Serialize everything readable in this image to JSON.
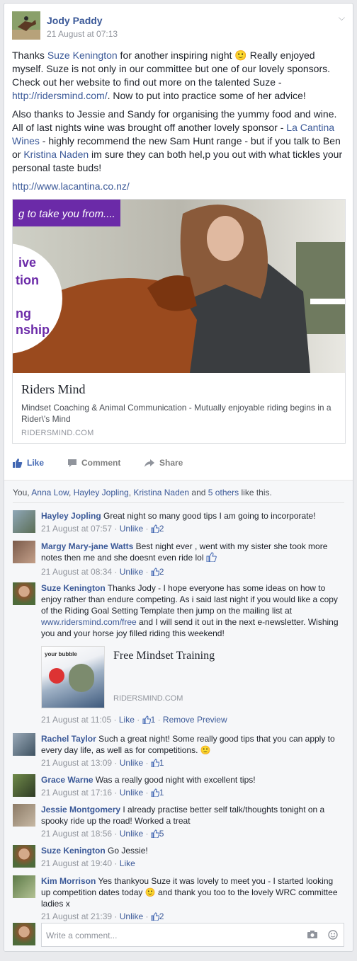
{
  "post": {
    "author": "Jody Paddy",
    "time": "21 August at 07:13",
    "para1": {
      "a": "Thanks ",
      "tag1": "Suze Kenington",
      "b": " for another inspiring night 🙂 Really enjoyed myself. Suze is not only in our committee but one of our lovely sponsors. Check out her website to find out more on the talented Suze - ",
      "link": "http://ridersmind.com/",
      "c": ". Now to put into practice some of her advice!"
    },
    "para2": {
      "a": "Also thanks to Jessie and Sandy for organising the yummy food and wine. All of last nights wine was brought off another lovely sponsor - ",
      "tag1": "La Cantina Wines",
      "b": " - highly recommend the new Sam Hunt range - but if you talk to Ben or ",
      "tag2": "Kristina Naden",
      "c": " im sure they can both hel,p you out with what tickles your personal taste buds!"
    },
    "para3_link": "http://www.lacantina.co.nz/"
  },
  "link_card": {
    "banner_text": "g to take you from....",
    "circle_lines": [
      "ive",
      "tion",
      "ng",
      "nship"
    ],
    "title": "Riders Mind",
    "description": "Mindset Coaching & Animal Communication - Mutually enjoyable riding begins in a Rider\\'s Mind",
    "domain": "RIDERSMIND.COM"
  },
  "actions": {
    "like": "Like",
    "comment": "Comment",
    "share": "Share"
  },
  "likes_summary": {
    "prefix": "You, ",
    "n1": "Anna Low",
    "sep1": ", ",
    "n2": "Hayley Jopling",
    "sep2": ", ",
    "n3": "Kristina Naden",
    "mid": " and ",
    "others": "5 others",
    "suffix": " like this."
  },
  "comments": [
    {
      "name": "Hayley Jopling",
      "text": " Great night so many good tips I am going to incorporate!",
      "time": "21 August at 07:57",
      "unlike": "Unlike",
      "likes": "2"
    },
    {
      "name": "Margy Mary-jane Watts",
      "text": " Best night ever , went with my sister she took more notes then me and she doesnt even ride lol",
      "time": "21 August at 08:34",
      "unlike": "Unlike",
      "likes": "2"
    },
    {
      "name": "Suze Kenington",
      "text": " Thanks Jody - I hope everyone has some ideas on how to enjoy rather than endure competing. As i said last night if you would like a copy of the Riding Goal Setting Template then jump on the mailing list at ",
      "link": "www.ridersmind.com/free",
      "text2": " and I will send it out in the next e-newsletter. Wishing you and your horse joy filled riding this weekend!",
      "preview_title": "Free Mindset Training",
      "preview_domain": "RIDERSMIND.COM",
      "preview_badge": "your bubble",
      "time": "21 August at 11:05",
      "like": "Like",
      "likes": "1",
      "remove": "Remove Preview"
    },
    {
      "name": "Rachel Taylor",
      "text": " Such a great night! Some really good tips that you can apply to every day life, as well as for competitions. 🙂",
      "time": "21 August at 13:09",
      "unlike": "Unlike",
      "likes": "1"
    },
    {
      "name": "Grace Warne",
      "text": " Was a really good night with excellent tips!",
      "time": "21 August at 17:16",
      "unlike": "Unlike",
      "likes": "1"
    },
    {
      "name": "Jessie Montgomery",
      "text": " I already practise better self talk/thoughts tonight on a spooky ride up the road! Worked a treat",
      "time": "21 August at 18:56",
      "unlike": "Unlike",
      "likes": "5"
    },
    {
      "name": "Suze Kenington",
      "text": " Go Jessie!",
      "time": "21 August at 19:40",
      "like": "Like"
    },
    {
      "name": "Kim Morrison",
      "text": " Yes thankyou Suze it was lovely to meet you - I started looking up competition dates today 🙂 and thank you too to the lovely WRC committee ladies x",
      "time": "21 August at 21:39",
      "unlike": "Unlike",
      "likes": "2"
    }
  ],
  "compose": {
    "placeholder": "Write a comment..."
  },
  "colors": {
    "link": "#3b5998",
    "background": "#e9eaed",
    "banner": "#6b2aa8"
  }
}
